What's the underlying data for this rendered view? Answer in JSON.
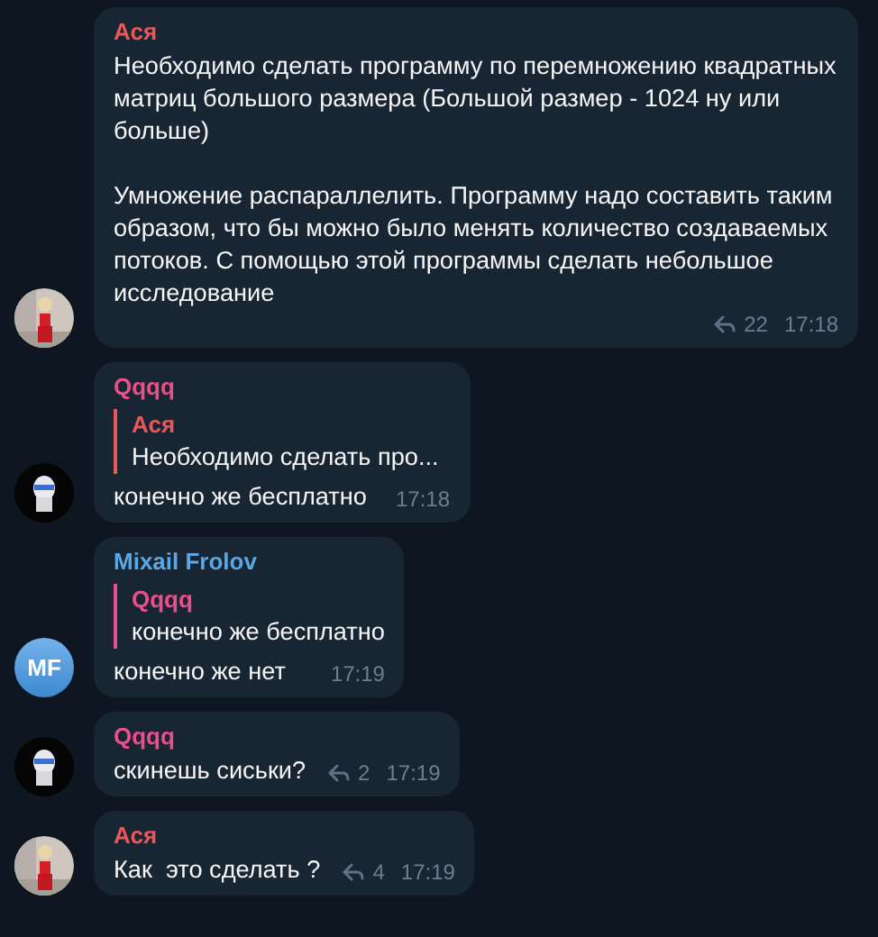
{
  "messages": [
    {
      "sender": "Ася",
      "color": "#e8575a",
      "avatar": {
        "kind": "picture"
      },
      "paragraphs": [
        "Необходимо сделать программу по перемножению квадратных матриц большого размера (Большой размер - 1024 ну или больше)",
        "Умножение распараллелить. Программу надо составить таким образом, что бы можно было менять количество создаваемых потоков. С помощью этой программы сделать небольшое исследование"
      ],
      "shares": "22",
      "time": "17:18"
    },
    {
      "sender": "Qqqq",
      "color": "#ea4f8b",
      "avatar": {
        "kind": "picture"
      },
      "reply": {
        "author": "Ася",
        "color": "#e8575a",
        "text": "Необходимо сделать про..."
      },
      "paragraphs": [
        "конечно же бесплатно"
      ],
      "time": "17:18"
    },
    {
      "sender": "Mixail Frolov",
      "color": "#5ba7e4",
      "avatar": {
        "kind": "initials",
        "text": "MF"
      },
      "reply": {
        "author": "Qqqq",
        "color": "#ea4f8b",
        "text": "конечно же бесплатно"
      },
      "paragraphs": [
        "конечно же нет"
      ],
      "time": "17:19"
    },
    {
      "sender": "Qqqq",
      "color": "#ea4f8b",
      "avatar": {
        "kind": "picture"
      },
      "paragraphs": [
        "скинешь сиськи?"
      ],
      "shares": "2",
      "time": "17:19"
    },
    {
      "sender": "Ася",
      "color": "#e8575a",
      "avatar": {
        "kind": "picture"
      },
      "paragraphs": [
        "Как  это сделать ?"
      ],
      "shares": "4",
      "time": "17:19"
    }
  ]
}
